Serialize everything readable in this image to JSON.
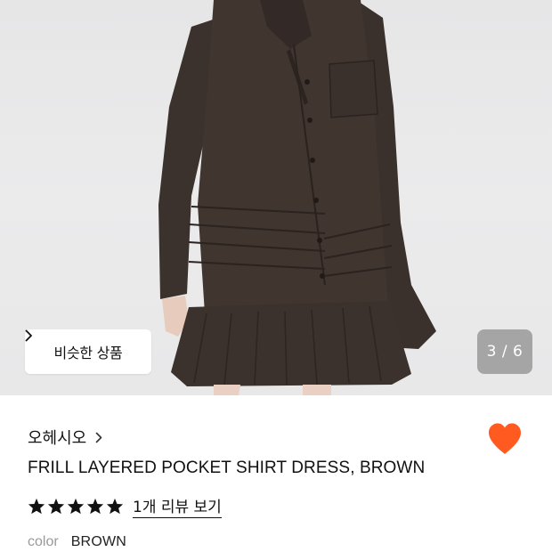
{
  "gallery": {
    "similar_label": "비슷한 상품",
    "counter": "3 / 6",
    "image": "model wearing brown frill layered pocket shirt dress"
  },
  "product": {
    "brand": "오헤시오",
    "title": "FRILL LAYERED POCKET SHIRT DRESS, BROWN",
    "rating_stars": 5,
    "review_link": "1개 리뷰 보기",
    "color_key": "color",
    "color_value": "BROWN",
    "wishlist_active": true
  },
  "colors": {
    "heart": "#ff5a1f",
    "text": "#111111",
    "muted": "#9a9a9a",
    "dress": "#3e3430"
  },
  "icons": {
    "similar_arrow": "chevron-right-icon",
    "brand_arrow": "chevron-right-icon",
    "wishlist": "heart-icon",
    "star": "star-icon"
  }
}
